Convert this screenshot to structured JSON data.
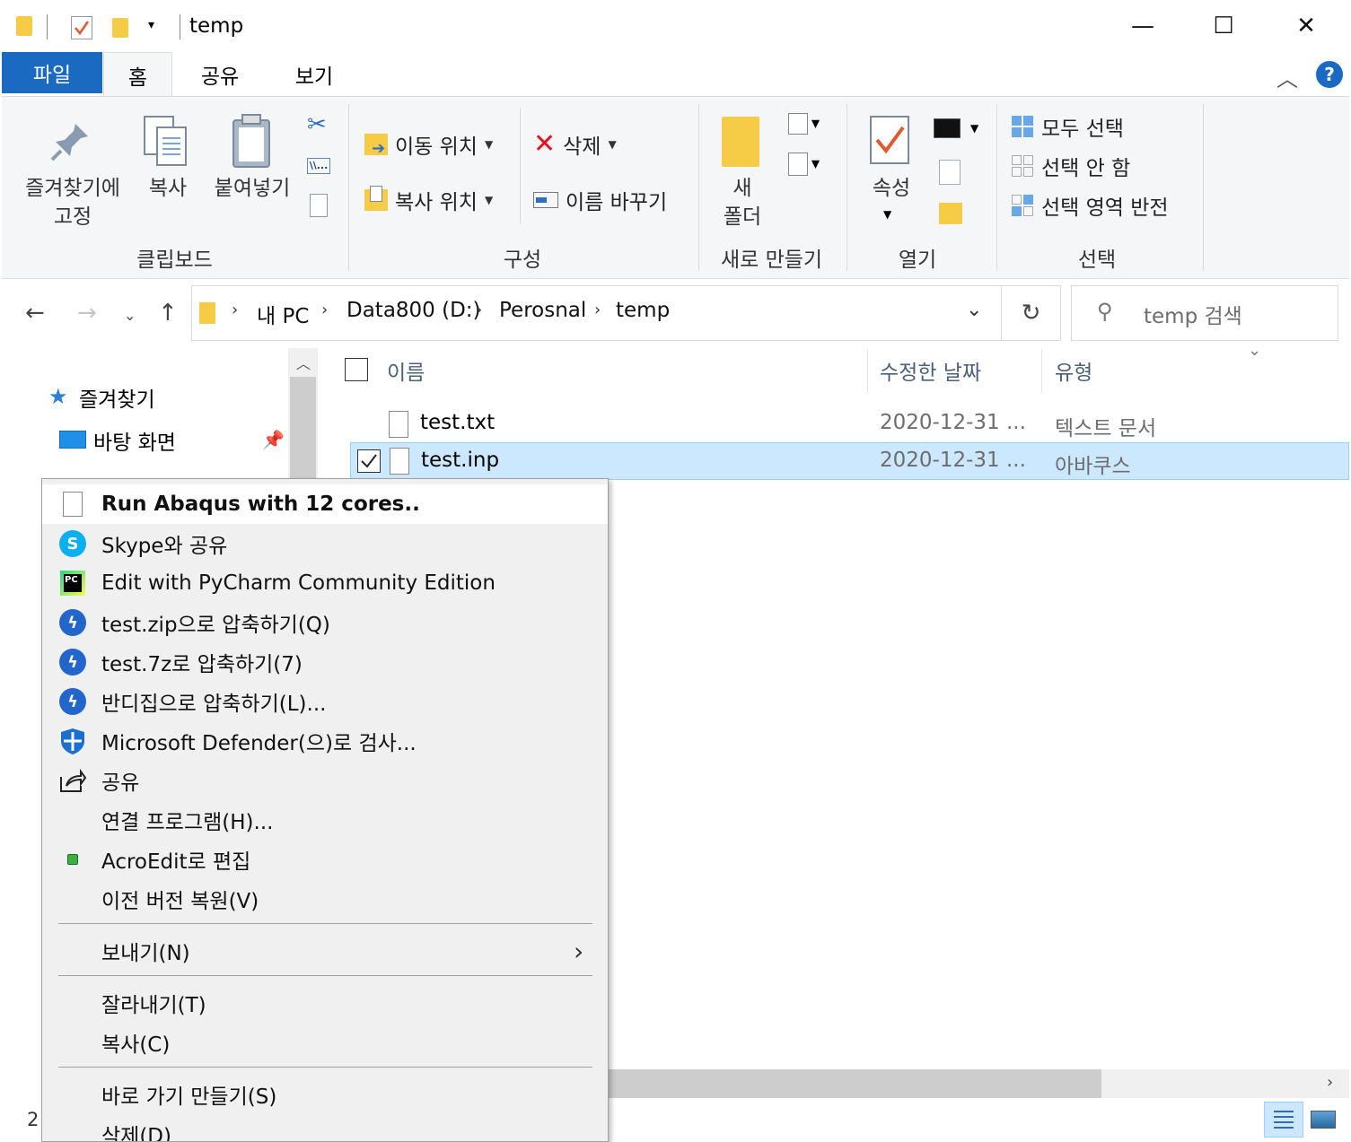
{
  "window": {
    "title": "temp",
    "minimize_glyph": "—",
    "maximize_glyph": "☐",
    "close_glyph": "✕"
  },
  "ribbon_tabs": {
    "file": "파일",
    "home": "홈",
    "share": "공유",
    "view": "보기"
  },
  "ribbon": {
    "clipboard": {
      "label": "클립보드",
      "pin_line1": "즐겨찾기에",
      "pin_line2": "고정",
      "copy": "복사",
      "paste": "붙여넣기"
    },
    "organize": {
      "label": "구성",
      "move_to": "이동 위치",
      "copy_to": "복사 위치",
      "delete": "삭제",
      "rename": "이름 바꾸기"
    },
    "new": {
      "label": "새로 만들기",
      "new_folder_line1": "새",
      "new_folder_line2": "폴더"
    },
    "open": {
      "label": "열기",
      "properties": "속성"
    },
    "select": {
      "label": "선택",
      "select_all": "모두 선택",
      "select_none": "선택 안 함",
      "invert": "선택 영역 반전"
    }
  },
  "address": {
    "crumbs": [
      "내 PC",
      "Data800 (D:)",
      "Perosnal",
      "temp"
    ],
    "search_placeholder": "temp 검색"
  },
  "nav_pane": {
    "quick_access": "즐겨찾기",
    "desktop": "바탕 화면"
  },
  "columns": {
    "name": "이름",
    "modified": "수정한 날짜",
    "type": "유형"
  },
  "files": [
    {
      "name": "test.txt",
      "modified": "2020-12-31 ...",
      "type": "텍스트 문서",
      "selected": false
    },
    {
      "name": "test.inp",
      "modified": "2020-12-31 ...",
      "type": "아바쿠스",
      "selected": true
    }
  ],
  "status": {
    "count": "2"
  },
  "context_menu": {
    "items": [
      {
        "label": "Run Abaqus with 12 cores..",
        "icon": "document-icon",
        "bold": true
      },
      {
        "label": "Skype와 공유",
        "icon": "skype-icon"
      },
      {
        "label": "Edit with PyCharm Community Edition",
        "icon": "pycharm-icon"
      },
      {
        "label": "test.zip으로 압축하기(Q)",
        "icon": "bandizip-icon"
      },
      {
        "label": "test.7z로 압축하기(7)",
        "icon": "bandizip-icon"
      },
      {
        "label": "반디집으로 압축하기(L)...",
        "icon": "bandizip-icon"
      },
      {
        "label": "Microsoft Defender(으)로 검사...",
        "icon": "defender-shield-icon"
      },
      {
        "label": "공유",
        "icon": "share-icon"
      },
      {
        "label": "연결 프로그램(H)...",
        "icon": ""
      },
      {
        "label": "AcroEdit로 편집",
        "icon": "acroedit-icon"
      },
      {
        "label": "이전 버전 복원(V)",
        "icon": ""
      },
      {
        "label": "보내기(N)",
        "icon": "",
        "submenu": true
      },
      {
        "label": "잘라내기(T)",
        "icon": ""
      },
      {
        "label": "복사(C)",
        "icon": ""
      },
      {
        "label": "바로 가기 만들기(S)",
        "icon": ""
      },
      {
        "label": "삭제(D)",
        "icon": ""
      }
    ]
  },
  "colors": {
    "file_tab": "#1b6ac1",
    "selection": "#cce8ff",
    "delete_red": "#e81123",
    "folder_yellow": "#f6cc47"
  }
}
